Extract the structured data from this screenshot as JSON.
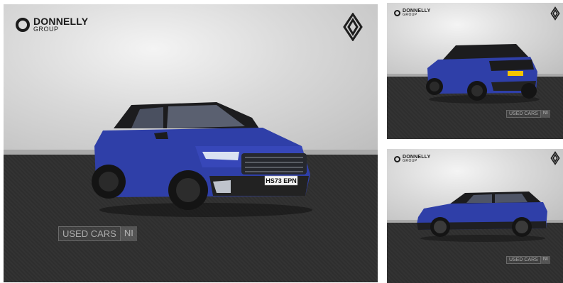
{
  "dealer": {
    "name": "DONNELLY",
    "sub": "GROUP"
  },
  "watermark": {
    "text": "USED CARS",
    "region": "NI"
  },
  "vehicle": {
    "plate": "HS73 EPN",
    "color": "#2f3fa8"
  },
  "photos": [
    {
      "view": "front-three-quarter"
    },
    {
      "view": "rear-three-quarter"
    },
    {
      "view": "side-profile"
    }
  ]
}
